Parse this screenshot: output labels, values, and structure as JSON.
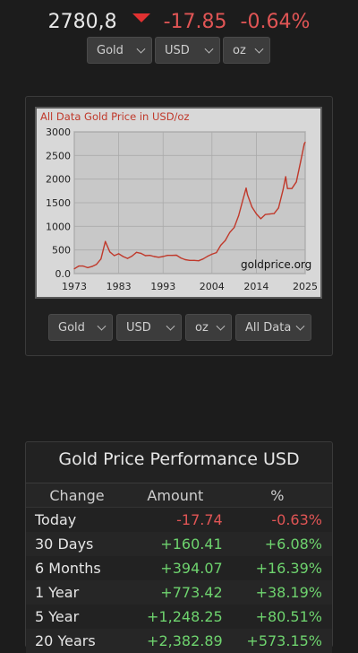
{
  "header": {
    "price": "2780,8",
    "change": "-17.85",
    "change_pct": "-0.64%"
  },
  "top_selects": [
    {
      "value": "Gold"
    },
    {
      "value": "USD"
    },
    {
      "value": "oz"
    }
  ],
  "bottom_selects": [
    {
      "value": "Gold"
    },
    {
      "value": "USD"
    },
    {
      "value": "oz"
    },
    {
      "value": "All Data"
    }
  ],
  "chart_data": {
    "type": "line",
    "title": "All Data Gold Price in USD/oz",
    "watermark": "goldprice.org",
    "xlabel": "",
    "ylabel": "",
    "x_ticks": [
      "1973",
      "1983",
      "1993",
      "2004",
      "2014",
      "2025"
    ],
    "y_ticks": [
      "0.0",
      "500",
      "1000",
      "1500",
      "2000",
      "2500",
      "3000"
    ],
    "xlim": [
      1973,
      2025
    ],
    "ylim": [
      0,
      3000
    ],
    "grid": true,
    "line_color": "#c0392b",
    "series": [
      {
        "x": [
          1973,
          1974,
          1975,
          1976,
          1977,
          1978,
          1979,
          1980,
          1981,
          1982,
          1983,
          1984,
          1985,
          1986,
          1987,
          1988,
          1989,
          1990,
          1991,
          1992,
          1993,
          1994,
          1995,
          1996,
          1997,
          1998,
          1999,
          2000,
          2001,
          2002,
          2003,
          2004,
          2005,
          2006,
          2007,
          2008,
          2009,
          2010,
          2011,
          2011.7,
          2012,
          2013,
          2014,
          2015,
          2016,
          2017,
          2018,
          2019,
          2020,
          2020.6,
          2021,
          2022,
          2023,
          2024,
          2024.8,
          2025
        ],
        "y": [
          100,
          160,
          160,
          125,
          150,
          195,
          310,
          680,
          460,
          380,
          420,
          360,
          320,
          370,
          450,
          430,
          380,
          385,
          360,
          345,
          360,
          385,
          385,
          390,
          330,
          295,
          280,
          280,
          272,
          310,
          365,
          410,
          445,
          600,
          700,
          870,
          975,
          1225,
          1570,
          1810,
          1670,
          1410,
          1265,
          1160,
          1250,
          1260,
          1270,
          1390,
          1770,
          2050,
          1800,
          1800,
          1940,
          2380,
          2750,
          2780
        ]
      }
    ]
  },
  "performance": {
    "title": "Gold Price Performance USD",
    "headers": [
      "Change",
      "Amount",
      "%"
    ],
    "rows": [
      {
        "label": "Today",
        "amount": "-17.74",
        "pct": "-0.63%",
        "dir": "neg"
      },
      {
        "label": "30 Days",
        "amount": "+160.41",
        "pct": "+6.08%",
        "dir": "pos"
      },
      {
        "label": "6 Months",
        "amount": "+394.07",
        "pct": "+16.39%",
        "dir": "pos"
      },
      {
        "label": "1 Year",
        "amount": "+773.42",
        "pct": "+38.19%",
        "dir": "pos"
      },
      {
        "label": "5 Year",
        "amount": "+1,248.25",
        "pct": "+80.51%",
        "dir": "pos"
      },
      {
        "label": "20 Years",
        "amount": "+2,382.89",
        "pct": "+573.15%",
        "dir": "pos"
      }
    ]
  }
}
